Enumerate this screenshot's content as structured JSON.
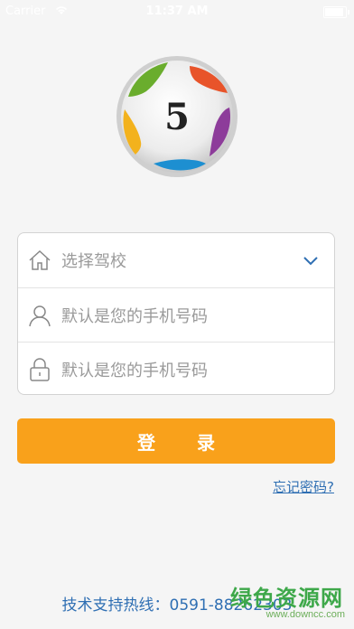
{
  "statusbar": {
    "carrier": "Carrier",
    "time": "11:37 AM"
  },
  "logo": {
    "number": "5",
    "colors": [
      "#e8542a",
      "#8d3c9a",
      "#1d8fd1",
      "#f3b21d",
      "#6aad2d"
    ]
  },
  "form": {
    "school_placeholder": "选择驾校",
    "phone_placeholder": "默认是您的手机号码",
    "password_placeholder": "默认是您的手机号码"
  },
  "login_button": "登录",
  "forgot_link": "忘记密码?",
  "hotline": "技术支持热线：0591-88262303",
  "watermark": {
    "title": "绿色资源网",
    "url": "www.downcc.com"
  },
  "colors": {
    "accent": "#f9a11b",
    "link": "#2f6fb3",
    "background": "#f5f5f5"
  }
}
